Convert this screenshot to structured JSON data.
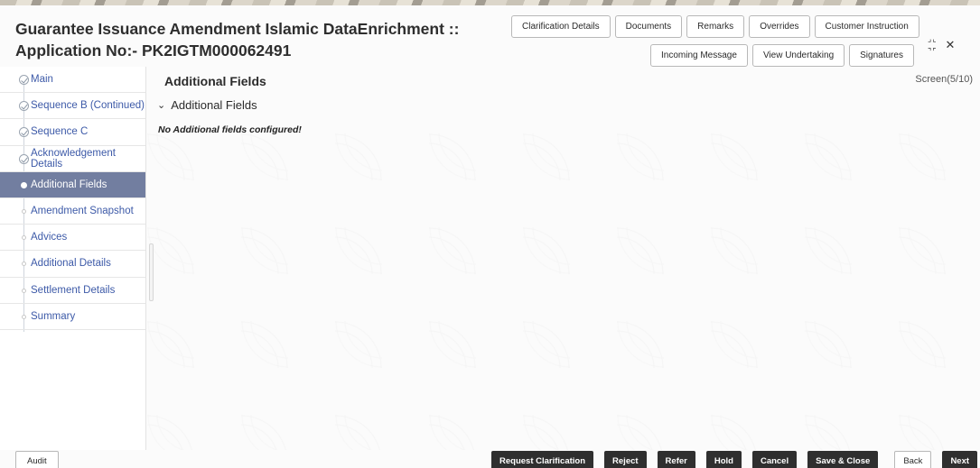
{
  "header": {
    "title_line1": "Guarantee Issuance Amendment Islamic DataEnrichment ::",
    "title_line2": "Application No:- PK2IGTM000062491",
    "buttons_row1": [
      "Clarification Details",
      "Documents",
      "Remarks",
      "Overrides",
      "Customer Instruction"
    ],
    "buttons_row2": [
      "Incoming Message",
      "View Undertaking",
      "Signatures"
    ],
    "icons": {
      "collapse": "collapse-icon",
      "close": "close-icon"
    }
  },
  "sidebar": {
    "items": [
      {
        "label": "Main",
        "state": "done"
      },
      {
        "label": "Sequence B (Continued)",
        "state": "done"
      },
      {
        "label": "Sequence C",
        "state": "done"
      },
      {
        "label": "Acknowledgement Details",
        "state": "done"
      },
      {
        "label": "Additional Fields",
        "state": "active"
      },
      {
        "label": "Amendment Snapshot",
        "state": "pending"
      },
      {
        "label": "Advices",
        "state": "pending"
      },
      {
        "label": "Additional Details",
        "state": "pending"
      },
      {
        "label": "Settlement Details",
        "state": "pending"
      },
      {
        "label": "Summary",
        "state": "pending"
      }
    ]
  },
  "main": {
    "section_title": "Additional Fields",
    "screen_indicator": "Screen(5/10)",
    "subsection_label": "Additional Fields",
    "empty_message": "No Additional fields configured!"
  },
  "footer": {
    "audit_label": "Audit",
    "action_buttons": [
      "Request Clarification",
      "Reject",
      "Refer",
      "Hold",
      "Cancel",
      "Save & Close"
    ],
    "nav_buttons": [
      "Back",
      "Next"
    ]
  },
  "colors": {
    "active_nav_bg": "#727ea0",
    "nav_link": "#3d5aa8",
    "primary_button": "#2f2f2f"
  }
}
